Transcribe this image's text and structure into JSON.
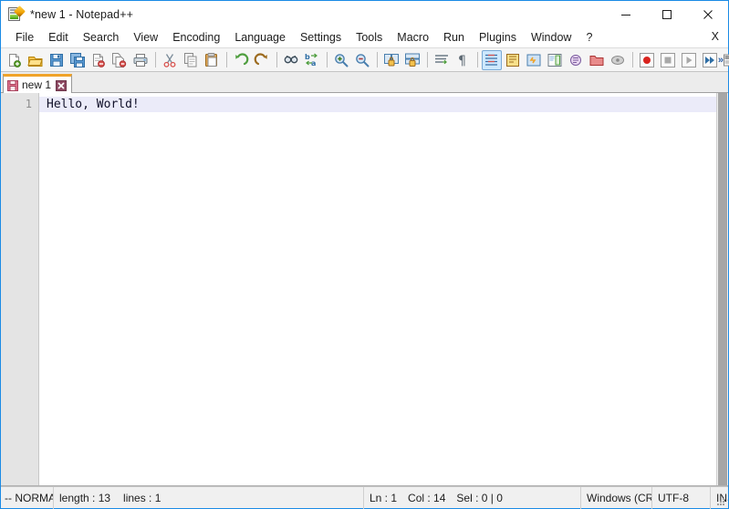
{
  "window": {
    "title": "*new 1 - Notepad++",
    "app_icon": "notepad-pencil-icon",
    "controls": {
      "minimize": "minimize-icon",
      "maximize": "maximize-icon",
      "close": "close-icon"
    },
    "border_color": "#1a8ae5"
  },
  "menu": {
    "items": [
      {
        "label": "File"
      },
      {
        "label": "Edit"
      },
      {
        "label": "Search"
      },
      {
        "label": "View"
      },
      {
        "label": "Encoding"
      },
      {
        "label": "Language"
      },
      {
        "label": "Settings"
      },
      {
        "label": "Tools"
      },
      {
        "label": "Macro"
      },
      {
        "label": "Run"
      },
      {
        "label": "Plugins"
      },
      {
        "label": "Window"
      },
      {
        "label": "?"
      }
    ],
    "close_document": "X"
  },
  "toolbar": {
    "overflow_label": "»",
    "buttons": [
      {
        "name": "new-file-icon",
        "tip": "New"
      },
      {
        "name": "open-file-icon",
        "tip": "Open"
      },
      {
        "name": "save-icon",
        "tip": "Save"
      },
      {
        "name": "save-all-icon",
        "tip": "Save All"
      },
      {
        "name": "close-file-icon",
        "tip": "Close"
      },
      {
        "name": "close-all-icon",
        "tip": "Close All"
      },
      {
        "name": "print-icon",
        "tip": "Print"
      },
      {
        "name": "separator",
        "tip": ""
      },
      {
        "name": "cut-icon",
        "tip": "Cut"
      },
      {
        "name": "copy-icon",
        "tip": "Copy"
      },
      {
        "name": "paste-icon",
        "tip": "Paste"
      },
      {
        "name": "separator",
        "tip": ""
      },
      {
        "name": "undo-icon",
        "tip": "Undo"
      },
      {
        "name": "redo-icon",
        "tip": "Redo"
      },
      {
        "name": "separator",
        "tip": ""
      },
      {
        "name": "find-icon",
        "tip": "Find"
      },
      {
        "name": "replace-icon",
        "tip": "Replace"
      },
      {
        "name": "separator",
        "tip": ""
      },
      {
        "name": "zoom-in-icon",
        "tip": "Zoom In"
      },
      {
        "name": "zoom-out-icon",
        "tip": "Zoom Out"
      },
      {
        "name": "separator",
        "tip": ""
      },
      {
        "name": "sync-vertical-icon",
        "tip": "Synchronize Vertical Scrolling"
      },
      {
        "name": "sync-horizontal-icon",
        "tip": "Synchronize Horizontal Scrolling"
      },
      {
        "name": "separator",
        "tip": ""
      },
      {
        "name": "word-wrap-icon",
        "tip": "Word Wrap"
      },
      {
        "name": "show-symbols-icon",
        "tip": "Show All Characters"
      },
      {
        "name": "separator",
        "tip": ""
      },
      {
        "name": "show-indent-guide-icon",
        "tip": "Show Indent Guide",
        "active": true
      },
      {
        "name": "user-define-dialog-icon",
        "tip": "User Defined Dialogue"
      },
      {
        "name": "function-list-icon",
        "tip": "Function List"
      },
      {
        "name": "document-map-icon",
        "tip": "Document Map"
      },
      {
        "name": "doc-switcher-icon",
        "tip": "Document Switcher"
      },
      {
        "name": "folder-workspace-icon",
        "tip": "Folder as Workspace"
      },
      {
        "name": "monitoring-icon",
        "tip": "Monitoring"
      },
      {
        "name": "separator",
        "tip": ""
      },
      {
        "name": "record-macro-icon",
        "tip": "Start Recording"
      },
      {
        "name": "stop-macro-icon",
        "tip": "Stop Recording"
      },
      {
        "name": "play-macro-icon",
        "tip": "Playback"
      },
      {
        "name": "play-multiple-icon",
        "tip": "Run a Macro Multiple Times"
      },
      {
        "name": "save-macro-icon",
        "tip": "Save Current Recorded Macro"
      }
    ]
  },
  "tabs": [
    {
      "label": "new 1",
      "modified": true,
      "active": true,
      "save_icon": "unsaved-floppy-icon",
      "close_icon": "tab-close-icon"
    }
  ],
  "editor": {
    "lines": [
      {
        "number": "1",
        "text": "Hello, World!",
        "current": true
      }
    ],
    "gutter_bg": "#e4e4e4",
    "current_line_bg": "#ebebf9"
  },
  "status_bar": {
    "mode": "-- NORMA",
    "doc_length_label": "length : 13",
    "doc_lines_label": "lines : 1",
    "caret_line": "Ln : 1",
    "caret_col": "Col : 14",
    "selection": "Sel : 0 | 0",
    "eol": "Windows (CR LF)",
    "encoding": "UTF-8",
    "insert_mode": "INS"
  }
}
